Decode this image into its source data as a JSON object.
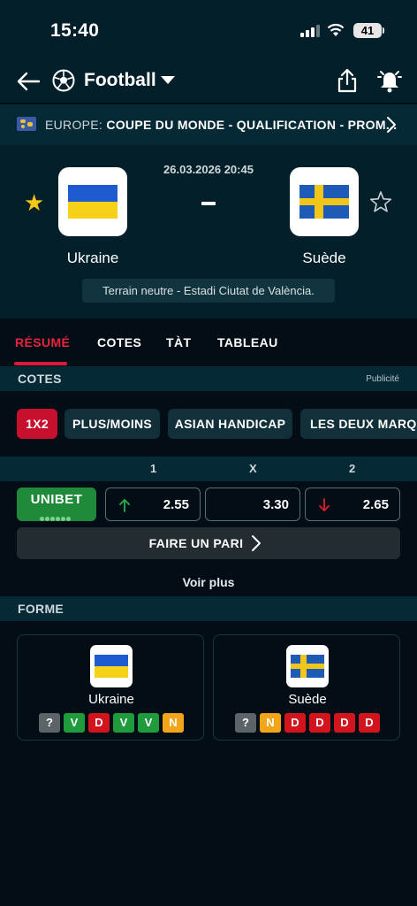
{
  "status_bar": {
    "time": "15:40",
    "battery": "41"
  },
  "header": {
    "sport": "Football"
  },
  "league": {
    "category": "EUROPE:",
    "name": "COUPE DU MONDE - QUALIFICATION - PROM..."
  },
  "match": {
    "datetime": "26.03.2026 20:45",
    "home_team": "Ukraine",
    "away_team": "Suède",
    "score_separator": "-",
    "venue": "Terrain neutre - Estadi Ciutat de València."
  },
  "tabs": [
    {
      "label": "RÉSUMÉ",
      "active": true
    },
    {
      "label": "COTES",
      "active": false
    },
    {
      "label": "TÀT",
      "active": false
    },
    {
      "label": "TABLEAU",
      "active": false
    }
  ],
  "odds_section": {
    "title": "COTES",
    "ad_label": "Publicité"
  },
  "bet_types": [
    "1X2",
    "PLUS/MOINS",
    "ASIAN HANDICAP",
    "LES DEUX MARQU"
  ],
  "odds_header": [
    "1",
    "X",
    "2"
  ],
  "bookmaker": {
    "name": "UNIBET",
    "odds": [
      {
        "value": "2.55",
        "trend": "up"
      },
      {
        "value": "3.30",
        "trend": "none"
      },
      {
        "value": "2.65",
        "trend": "down"
      }
    ]
  },
  "bet_button": "FAIRE UN PARI",
  "see_more": "Voir plus",
  "form_section": {
    "title": "FORME"
  },
  "form": {
    "home": {
      "team": "Ukraine",
      "results": [
        "?",
        "V",
        "D",
        "V",
        "V",
        "N"
      ]
    },
    "away": {
      "team": "Suède",
      "results": [
        "?",
        "N",
        "D",
        "D",
        "D",
        "D"
      ]
    }
  },
  "colors": {
    "accent": "#c8102e",
    "win": "#1f9a3c",
    "loss": "#d1141e",
    "draw": "#f0a51a",
    "bookmaker": "#1f8b3a"
  }
}
